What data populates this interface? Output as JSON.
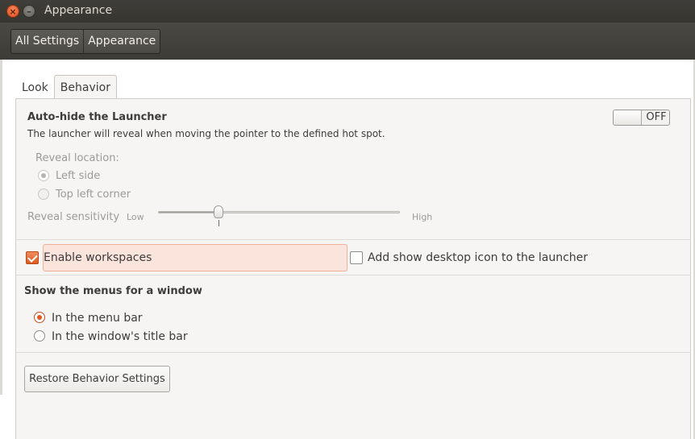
{
  "window": {
    "title": "Appearance",
    "close_glyph": "×",
    "minimize_glyph": "–"
  },
  "breadcrumb": {
    "items": [
      "All Settings",
      "Appearance"
    ]
  },
  "tabs": [
    {
      "label": "Look",
      "active": false
    },
    {
      "label": "Behavior",
      "active": true
    }
  ],
  "autohide": {
    "title": "Auto-hide the Launcher",
    "description": "The launcher will reveal when moving the pointer to the defined hot spot.",
    "toggle_state": "OFF",
    "reveal_location_label": "Reveal location:",
    "reveal_options": [
      {
        "label": "Left side",
        "selected": true
      },
      {
        "label": "Top left corner",
        "selected": false
      }
    ],
    "sensitivity_label": "Reveal sensitivity",
    "sensitivity_low": "Low",
    "sensitivity_high": "High",
    "sensitivity_value": 0.25,
    "enabled": false
  },
  "workspaces": {
    "enable_label": "Enable workspaces",
    "enable_checked": true,
    "desktop_icon_label": "Add show desktop icon to the launcher",
    "desktop_icon_checked": false
  },
  "menus": {
    "title": "Show the menus for a window",
    "options": [
      {
        "label": "In the menu bar",
        "selected": true
      },
      {
        "label": "In the window's title bar",
        "selected": false
      }
    ]
  },
  "restore_button": "Restore Behavior Settings",
  "colors": {
    "accent": "#e05a24",
    "titlebar": "#3c3b37",
    "highlight": "#fae4dc"
  }
}
